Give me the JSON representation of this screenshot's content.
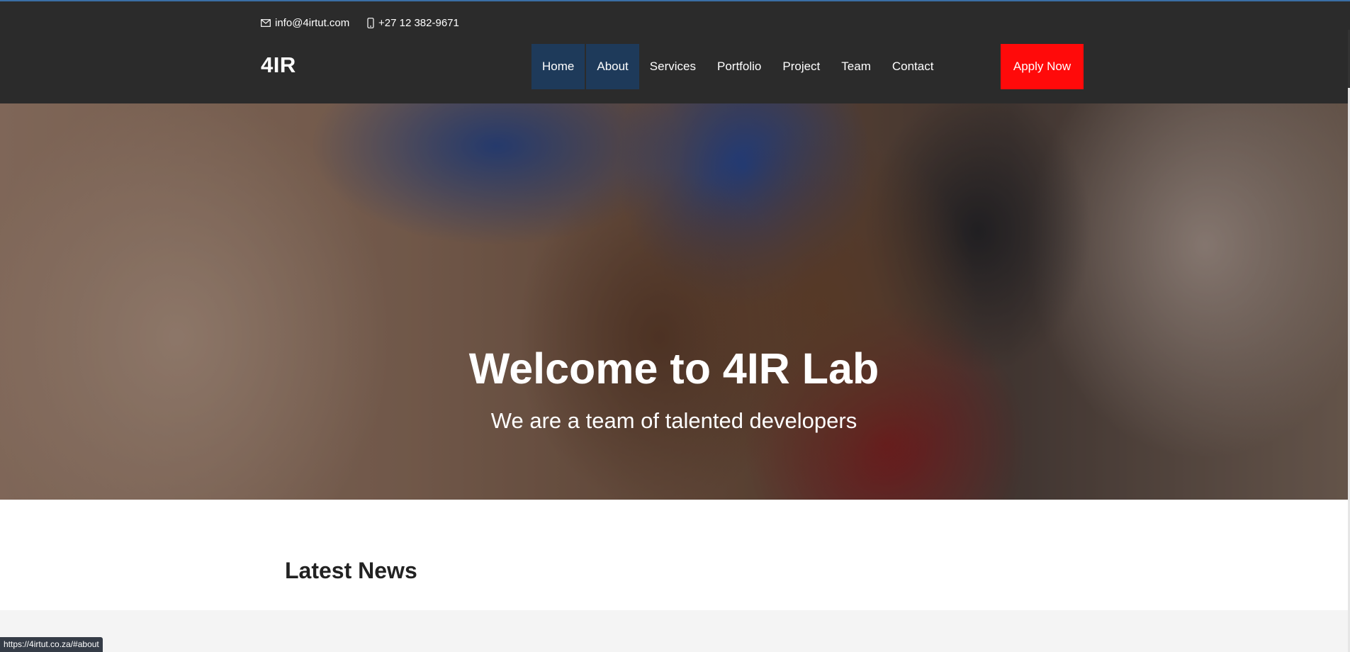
{
  "topbar": {
    "email": "info@4irtut.com",
    "phone": "+27 12 382-9671",
    "icons": {
      "email": "envelope-icon",
      "phone": "mobile-phone-icon"
    }
  },
  "header": {
    "logo": "4IR",
    "nav": [
      {
        "label": "Home",
        "state": "active"
      },
      {
        "label": "About",
        "state": "hovered"
      },
      {
        "label": "Services",
        "state": ""
      },
      {
        "label": "Portfolio",
        "state": ""
      },
      {
        "label": "Project",
        "state": ""
      },
      {
        "label": "Team",
        "state": ""
      },
      {
        "label": "Contact",
        "state": ""
      }
    ],
    "apply_label": "Apply Now"
  },
  "hero": {
    "title": "Welcome to 4IR Lab",
    "subtitle": "We are a team of talented developers"
  },
  "news": {
    "heading": "Latest News"
  },
  "statusbar": {
    "url": "https://4irtut.co.za/#about"
  },
  "colors": {
    "dark_bg": "#2b2b2b",
    "nav_active": "#1e3a5a",
    "apply_button": "#ff0a0a",
    "section_grey": "#f4f4f4"
  }
}
